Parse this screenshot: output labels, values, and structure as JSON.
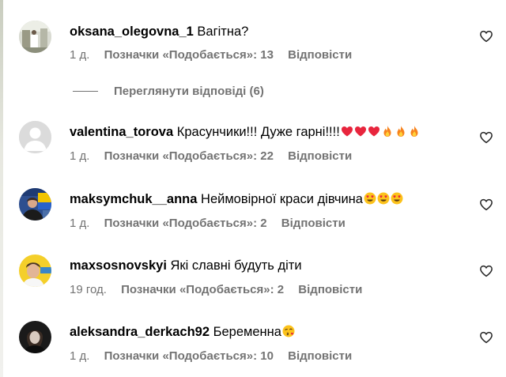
{
  "icons": {
    "like": "heart-outline-icon",
    "emoji_heart": "red-heart",
    "emoji_fire": "fire",
    "emoji_heart_eyes": "smiling-face-with-heart-eyes",
    "emoji_kiss": "face-blowing-a-kiss"
  },
  "colors": {
    "meta_text": "#737373",
    "heart_emoji": "#e8253d",
    "fire_emoji": "#f7831d",
    "emoji_face": "#fcc21b"
  },
  "comments": [
    {
      "username": "oksana_olegovna_1",
      "text": "Вагітна?",
      "time": "1 д.",
      "likes_label": "Позначки «Подобається»: 13",
      "reply_label": "Відповісти",
      "view_replies": "Переглянути відповіді (6)"
    },
    {
      "username": "valentina_torova",
      "text": "Красунчики!!! Дуже гарні!!!!",
      "emojis": [
        "red-heart",
        "red-heart",
        "red-heart",
        "fire",
        "fire",
        "fire"
      ],
      "time": "1 д.",
      "likes_label": "Позначки «Подобається»: 22",
      "reply_label": "Відповісти"
    },
    {
      "username": "maksymchuk__anna",
      "text": "Неймовірної краси дівчина",
      "emojis": [
        "smiling-face-with-heart-eyes",
        "smiling-face-with-heart-eyes",
        "smiling-face-with-heart-eyes"
      ],
      "time": "1 д.",
      "likes_label": "Позначки «Подобається»: 2",
      "reply_label": "Відповісти"
    },
    {
      "username": "maxsosnovskyi",
      "text": "Які славні будуть діти",
      "time": "19 год.",
      "likes_label": "Позначки «Подобається»: 2",
      "reply_label": "Відповісти"
    },
    {
      "username": "aleksandra_derkach92",
      "text": "Беременна",
      "emojis": [
        "face-blowing-a-kiss"
      ],
      "time": "1 д.",
      "likes_label": "Позначки «Подобається»: 10",
      "reply_label": "Відповісти"
    }
  ]
}
